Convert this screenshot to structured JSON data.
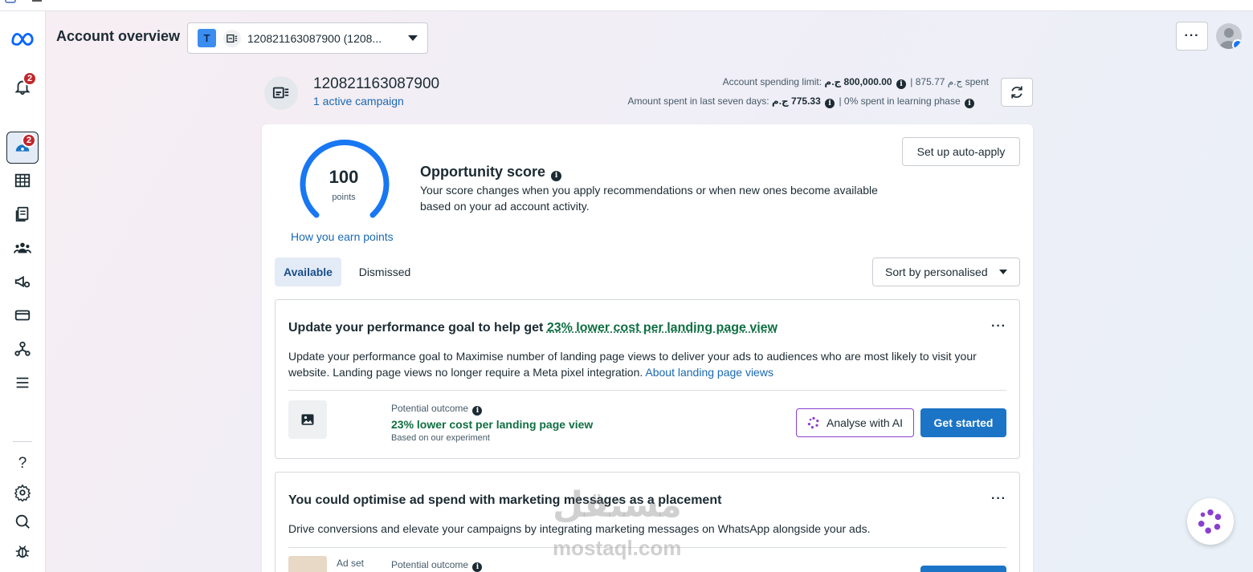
{
  "header": {
    "title": "Account overview",
    "account_initial": "T",
    "account_selector_text": "120821163087900 (1208..."
  },
  "sidebar": {
    "notifications_badge": "2",
    "active_badge": "2",
    "help_glyph": "?"
  },
  "account": {
    "id": "120821163087900",
    "campaigns": "1 active campaign",
    "spending_limit_label": "Account spending limit:",
    "spending_limit_value": "800,000.00 ج.م",
    "spent_text": "| ج.م 875.77 spent",
    "seven_days_label": "Amount spent in last seven days:",
    "seven_days_value": "775.33 ج.م",
    "learning_text": "| 0% spent in learning phase"
  },
  "score": {
    "value": "100",
    "unit": "points",
    "fraction": 1.0,
    "earn_link": "How you earn points",
    "title": "Opportunity score",
    "description": "Your score changes when you apply recommendations or when new ones become available based on your ad account activity.",
    "auto_apply": "Set up auto-apply"
  },
  "tabs": {
    "available": "Available",
    "dismissed": "Dismissed",
    "sort": "Sort by personalised"
  },
  "recommendations": [
    {
      "title_prefix": "Update your performance goal to help get ",
      "title_highlight": "23% lower cost per landing page view",
      "description": "Update your performance goal to Maximise number of landing page views to deliver your ads to audiences who are most likely to visit your website. Landing page views no longer require a Meta pixel integration. ",
      "link": "About landing page views",
      "outcome_label": "Potential outcome",
      "outcome_value": "23% lower cost per landing page view",
      "outcome_note": "Based on our experiment",
      "ai_button": "Analyse with AI",
      "cta": "Get started"
    },
    {
      "title": "You could optimise ad spend with marketing messages as a placement",
      "description": "Drive conversions and elevate your campaigns by integrating marketing messages on WhatsApp alongside your ads.",
      "adset_label": "Ad set",
      "outcome_label": "Potential outcome"
    }
  ],
  "watermark": {
    "arabic": "مستقل",
    "latin": "mostaql.com"
  },
  "colors": {
    "accent_blue": "#1b74c5",
    "link_blue": "#1a68b4",
    "success_green": "#0f6e43",
    "badge_red": "#c0272d",
    "ai_purple": "#8a3fd1"
  }
}
